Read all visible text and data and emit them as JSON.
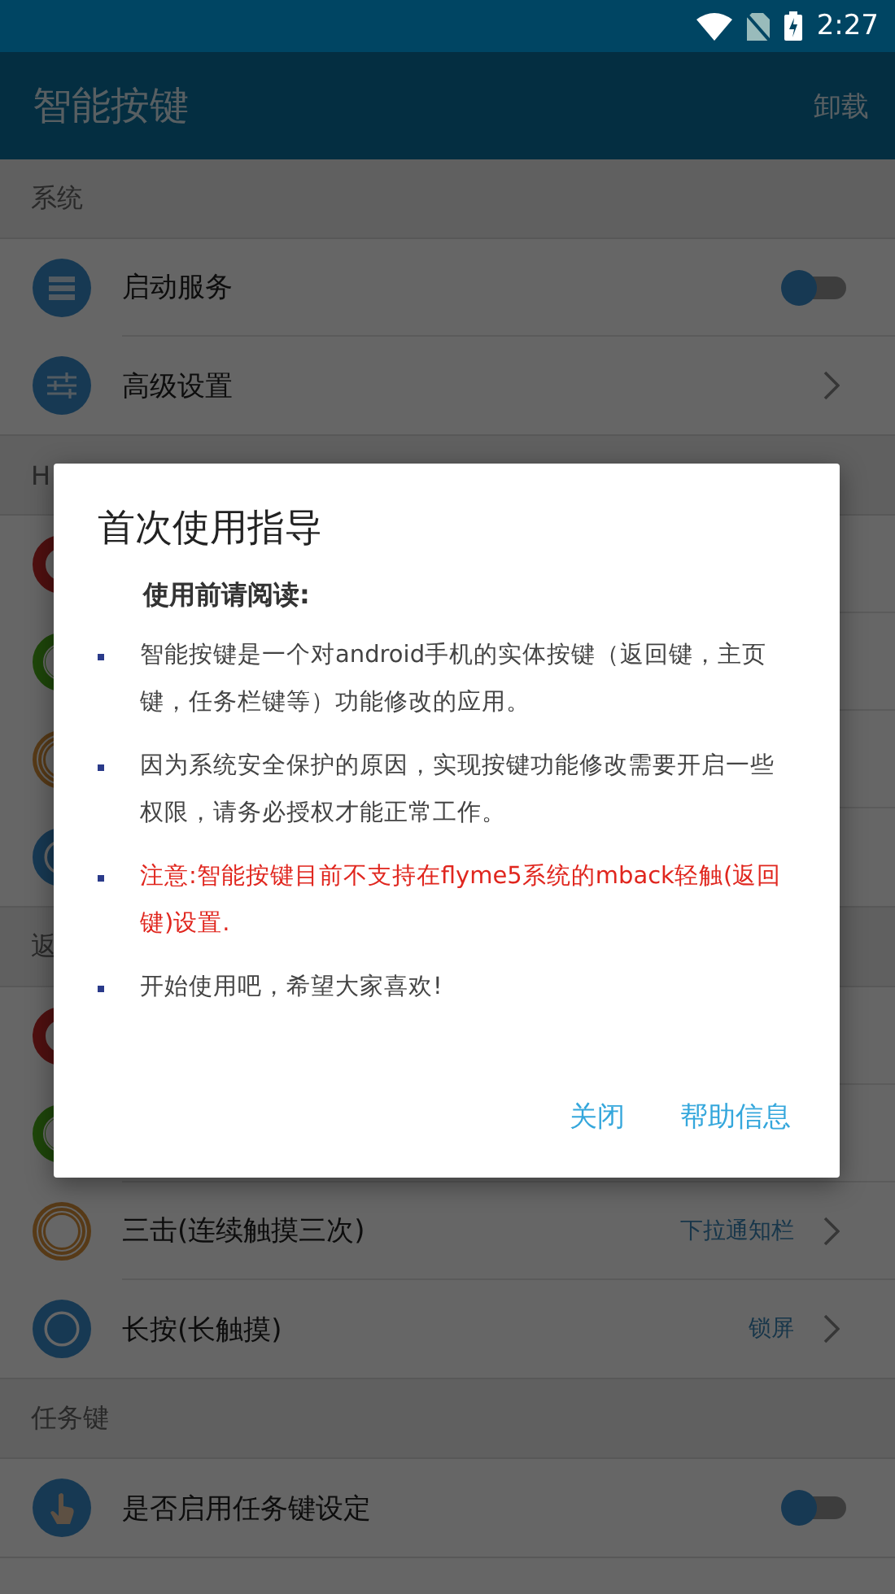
{
  "status_bar": {
    "time": "2:27"
  },
  "app_bar": {
    "title": "智能按键",
    "action": "卸载"
  },
  "sections": [
    {
      "header": "系统",
      "rows": [
        {
          "kind": "service",
          "label": "启动服务",
          "on": false
        },
        {
          "kind": "advanced",
          "label": "高级设置"
        }
      ]
    },
    {
      "header": "H",
      "rows": [
        {
          "kind": "tap1"
        },
        {
          "kind": "tap2"
        },
        {
          "kind": "tap3"
        },
        {
          "kind": "hold"
        }
      ]
    },
    {
      "header": "返",
      "rows": [
        {
          "kind": "tap1"
        },
        {
          "kind": "tap2"
        },
        {
          "kind": "tap3",
          "label": "三击(连续触摸三次)",
          "value": "下拉通知栏"
        },
        {
          "kind": "hold",
          "label": "长按(长触摸)",
          "value": "锁屏"
        }
      ]
    },
    {
      "header": "任务键",
      "rows": [
        {
          "kind": "task",
          "label": "是否启用任务键设定",
          "on": false
        }
      ]
    }
  ],
  "dialog": {
    "title": "首次使用指导",
    "subtitle": "使用前请阅读:",
    "items": [
      {
        "kind": "normal",
        "text": "智能按键是一个对android手机的实体按键（返回键，主页键，任务栏键等）功能修改的应用。"
      },
      {
        "kind": "normal",
        "text": "因为系统安全保护的原因，实现按键功能修改需要开启一些权限，请务必授权才能正常工作。"
      },
      {
        "kind": "warning",
        "text": "注意:智能按键目前不支持在flyme5系统的mback轻触(返回键)设置."
      },
      {
        "kind": "normal",
        "text": "开始使用吧，希望大家喜欢!"
      }
    ],
    "buttons": [
      "关闭",
      "帮助信息"
    ]
  }
}
